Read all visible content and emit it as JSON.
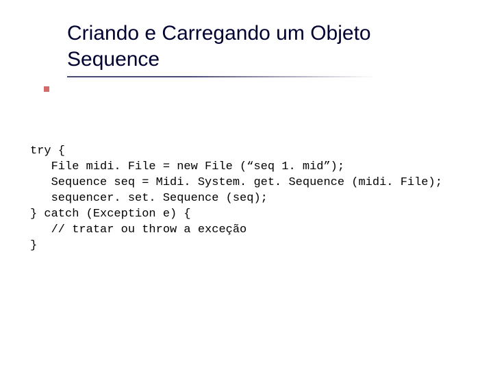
{
  "title": {
    "line1": "Criando e Carregando um Objeto",
    "line2": "Sequence"
  },
  "code": {
    "l1": "try {",
    "l2": "   File midi. File = new File (“seq 1. mid”);",
    "l3": "   Sequence seq = Midi. System. get. Sequence (midi. File);",
    "l4": "   sequencer. set. Sequence (seq);",
    "l5": "} catch (Exception e) {",
    "l6": "   // tratar ou throw a exceção",
    "l7": "}"
  }
}
